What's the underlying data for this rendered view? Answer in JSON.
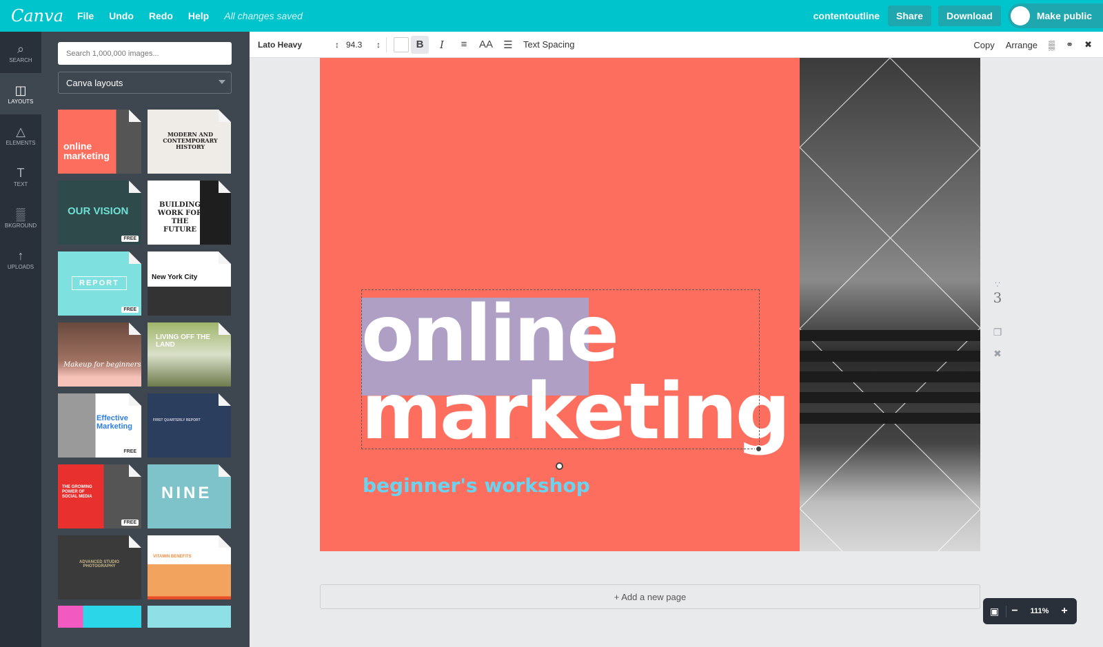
{
  "app": {
    "logo": "Canva",
    "menu": [
      "File",
      "Undo",
      "Redo",
      "Help"
    ],
    "save_status": "All changes saved",
    "team_name": "contentoutline",
    "share_label": "Share",
    "download_label": "Download",
    "make_public_label": "Make public"
  },
  "rail": {
    "items": [
      {
        "label": "SEARCH",
        "icon": "search-icon"
      },
      {
        "label": "LAYOUTS",
        "icon": "layouts-icon"
      },
      {
        "label": "ELEMENTS",
        "icon": "elements-icon"
      },
      {
        "label": "TEXT",
        "icon": "text-icon"
      },
      {
        "label": "BKGROUND",
        "icon": "background-icon"
      },
      {
        "label": "UPLOADS",
        "icon": "uploads-icon"
      }
    ]
  },
  "panel": {
    "search_placeholder": "Search 1,000,000 images...",
    "dropdown_value": "Canva layouts",
    "free_label": "FREE",
    "thumbnails": [
      "online marketing",
      "MODERN AND CONTEMPORARY HISTORY",
      "OUR VISION",
      "BUILDING WORK FOR THE FUTURE",
      "REPORT",
      "New York City",
      "Makeup for beginners",
      "LIVING OFF THE LAND",
      "Effective Marketing",
      "FIRST QUARTERLY REPORT",
      "THE GROWING POWER OF SOCIAL MEDIA",
      "NINE",
      "ADVANCED STUDIO PHOTOGRAPHY",
      "VITAMIN BENEFITS"
    ]
  },
  "toolbar": {
    "font": "Lato Heavy",
    "size": "94.3",
    "bold": "B",
    "italic": "I",
    "case": "AA",
    "text_spacing": "Text Spacing",
    "copy": "Copy",
    "arrange": "Arrange"
  },
  "design": {
    "line1": "online",
    "line2": "marketing",
    "subtitle": "beginner's workshop",
    "coral_color": "#fe6e5e",
    "subtitle_color": "#6ad3ef"
  },
  "page_number": "3",
  "add_page": "+ Add a new page",
  "zoom": "111%"
}
